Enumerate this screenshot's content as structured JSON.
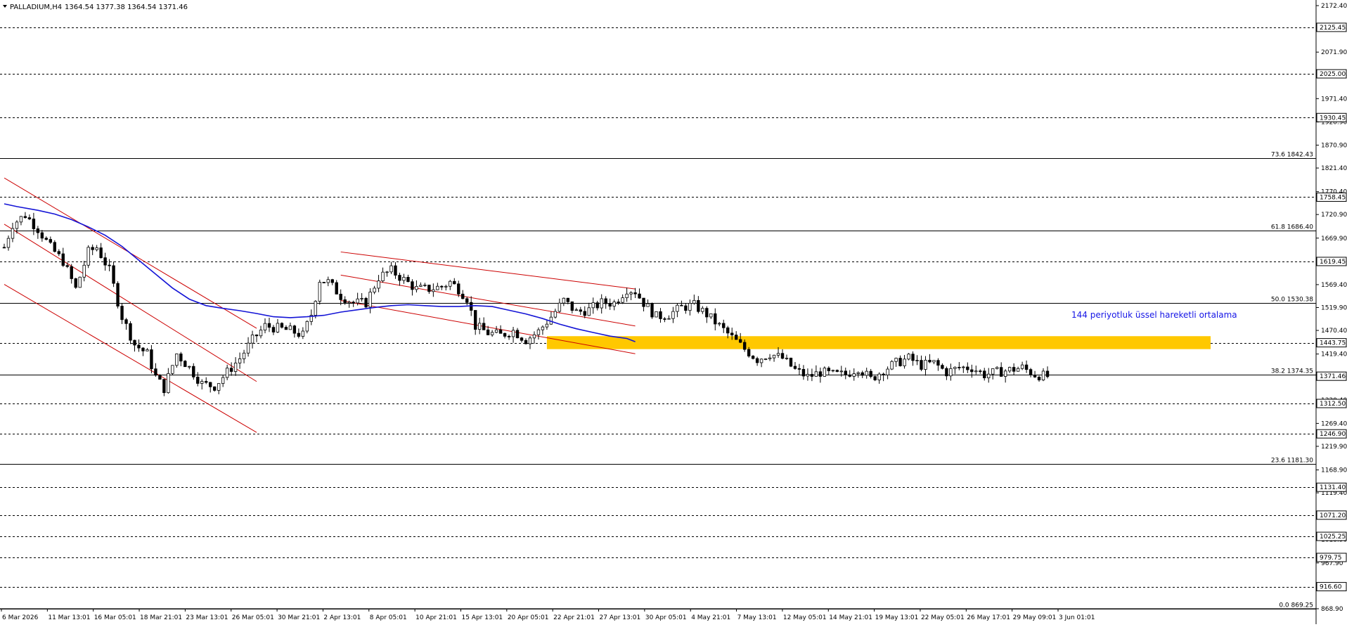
{
  "header": {
    "title": "PALLADIUM,H4",
    "ohlc": "1364.54 1377.38 1364.54 1371.46"
  },
  "annotation": {
    "text": "144 periyotluk üssel hareketli ortalama",
    "color": "#1515e6"
  },
  "colors": {
    "candles": "#000000",
    "ema": "#1414d6",
    "channels": "#cc0000",
    "zone": "#ffc800",
    "levels": "#000000",
    "background": "#ffffff"
  },
  "chart_data": {
    "type": "candlestick",
    "symbol": "PALLADIUM",
    "timeframe": "H4",
    "ylim": [
      868.9,
      2172.4
    ],
    "y_ticks": [
      "2172.40",
      "2121.40",
      "2071.90",
      "2021.40",
      "1971.40",
      "1920.90",
      "1870.90",
      "1821.40",
      "1770.40",
      "1720.90",
      "1669.90",
      "1619.40",
      "1569.40",
      "1519.90",
      "1470.40",
      "1419.40",
      "1369.90",
      "1320.40",
      "1269.40",
      "1219.90",
      "1168.90",
      "1119.40",
      "1068.40",
      "1018.90",
      "967.90",
      "916.90",
      "868.90"
    ],
    "x_labels": [
      "6 Mar 2026",
      "11 Mar 13:01",
      "16 Mar 05:01",
      "18 Mar 21:01",
      "23 Mar 13:01",
      "26 Mar 05:01",
      "30 Mar 21:01",
      "2 Apr 13:01",
      "8 Apr 05:01",
      "10 Apr 21:01",
      "15 Apr 13:01",
      "20 Apr 05:01",
      "22 Apr 21:01",
      "27 Apr 13:01",
      "30 Apr 05:01",
      "4 May 21:01",
      "7 May 13:01",
      "12 May 05:01",
      "14 May 21:01",
      "19 May 13:01",
      "22 May 05:01",
      "26 May 17:01",
      "29 May 09:01",
      "3 Jun 01:01"
    ],
    "horizontal_levels": [
      {
        "price": 2125.45,
        "label": "2125.45",
        "style": "dashed"
      },
      {
        "price": 2025.0,
        "label": "2025.00",
        "style": "dashed"
      },
      {
        "price": 1930.45,
        "label": "1930.45",
        "style": "dashed"
      },
      {
        "price": 1758.45,
        "label": "1758.45",
        "style": "dashed"
      },
      {
        "price": 1619.45,
        "label": "1619.45",
        "style": "dashed"
      },
      {
        "price": 1443.75,
        "label": "1443.75",
        "style": "dashed"
      },
      {
        "price": 1312.5,
        "label": "1312.50",
        "style": "dashed"
      },
      {
        "price": 1246.9,
        "label": "1246.90",
        "style": "dashed"
      },
      {
        "price": 1131.4,
        "label": "1131.40",
        "style": "dashed"
      },
      {
        "price": 1071.2,
        "label": "1071.20",
        "style": "dashed"
      },
      {
        "price": 1025.25,
        "label": "1025.25",
        "style": "dashed"
      },
      {
        "price": 979.75,
        "label": "979.75",
        "style": "dashed"
      },
      {
        "price": 916.6,
        "label": "916.60",
        "style": "dashed"
      }
    ],
    "current_price": {
      "price": 1371.46,
      "label": "1371.46"
    },
    "fibonacci": [
      {
        "level": "73.6",
        "price": 1842.43,
        "label": "73.6 1842.43"
      },
      {
        "level": "61.8",
        "price": 1686.4,
        "label": "61.8 1686.40"
      },
      {
        "level": "50.0",
        "price": 1530.38,
        "label": "50.0 1530.38"
      },
      {
        "level": "38.2",
        "price": 1374.35,
        "label": "38.2 1374.35"
      },
      {
        "level": "23.6",
        "price": 1181.3,
        "label": "23.6 1181.30"
      },
      {
        "level": "0.0",
        "price": 869.25,
        "label": "0.0 869.25"
      }
    ],
    "zone": {
      "price_from": 1430,
      "price_to": 1458
    },
    "ema_144": [
      [
        0,
        1744
      ],
      [
        3,
        1738
      ],
      [
        8,
        1730
      ],
      [
        12,
        1722
      ],
      [
        16,
        1710
      ],
      [
        20,
        1694
      ],
      [
        24,
        1676
      ],
      [
        28,
        1652
      ],
      [
        32,
        1622
      ],
      [
        36,
        1592
      ],
      [
        40,
        1562
      ],
      [
        44,
        1538
      ],
      [
        48,
        1524
      ],
      [
        52,
        1518
      ],
      [
        56,
        1513
      ],
      [
        60,
        1507
      ],
      [
        64,
        1500
      ],
      [
        68,
        1498
      ],
      [
        72,
        1500
      ],
      [
        76,
        1503
      ],
      [
        80,
        1510
      ],
      [
        84,
        1515
      ],
      [
        88,
        1520
      ],
      [
        92,
        1524
      ],
      [
        96,
        1526
      ],
      [
        100,
        1524
      ],
      [
        104,
        1522
      ],
      [
        108,
        1522
      ],
      [
        112,
        1524
      ],
      [
        116,
        1522
      ],
      [
        120,
        1514
      ],
      [
        124,
        1506
      ],
      [
        128,
        1496
      ],
      [
        132,
        1484
      ],
      [
        136,
        1474
      ],
      [
        140,
        1466
      ],
      [
        144,
        1458
      ],
      [
        148,
        1453
      ],
      [
        150,
        1446
      ]
    ],
    "candle_path": [
      [
        0,
        1650
      ],
      [
        2,
        1700
      ],
      [
        5,
        1720
      ],
      [
        8,
        1690
      ],
      [
        11,
        1650
      ],
      [
        14,
        1620
      ],
      [
        17,
        1560
      ],
      [
        20,
        1640
      ],
      [
        22,
        1650
      ],
      [
        25,
        1600
      ],
      [
        28,
        1500
      ],
      [
        31,
        1440
      ],
      [
        34,
        1420
      ],
      [
        36,
        1370
      ],
      [
        38,
        1345
      ],
      [
        41,
        1420
      ],
      [
        44,
        1390
      ],
      [
        47,
        1355
      ],
      [
        50,
        1350
      ],
      [
        53,
        1380
      ],
      [
        56,
        1410
      ],
      [
        59,
        1450
      ],
      [
        62,
        1480
      ],
      [
        65,
        1475
      ],
      [
        68,
        1470
      ],
      [
        71,
        1460
      ],
      [
        73,
        1505
      ],
      [
        75,
        1580
      ],
      [
        77,
        1575
      ],
      [
        80,
        1545
      ],
      [
        83,
        1530
      ],
      [
        86,
        1530
      ],
      [
        89,
        1585
      ],
      [
        92,
        1600
      ],
      [
        95,
        1580
      ],
      [
        98,
        1560
      ],
      [
        101,
        1560
      ],
      [
        104,
        1565
      ],
      [
        106,
        1575
      ],
      [
        108,
        1560
      ],
      [
        110,
        1540
      ],
      [
        112,
        1480
      ],
      [
        115,
        1465
      ],
      [
        118,
        1460
      ],
      [
        121,
        1470
      ],
      [
        124,
        1450
      ],
      [
        127,
        1468
      ],
      [
        130,
        1500
      ],
      [
        133,
        1535
      ],
      [
        136,
        1510
      ],
      [
        139,
        1515
      ],
      [
        142,
        1530
      ],
      [
        145,
        1530
      ],
      [
        148,
        1560
      ],
      [
        150,
        1555
      ],
      [
        152,
        1530
      ],
      [
        155,
        1500
      ],
      [
        158,
        1505
      ],
      [
        161,
        1520
      ],
      [
        164,
        1525
      ],
      [
        167,
        1505
      ],
      [
        170,
        1480
      ],
      [
        173,
        1455
      ],
      [
        176,
        1430
      ],
      [
        179,
        1408
      ],
      [
        182,
        1420
      ],
      [
        185,
        1410
      ],
      [
        188,
        1385
      ],
      [
        191,
        1370
      ],
      [
        194,
        1380
      ],
      [
        197,
        1375
      ],
      [
        200,
        1375
      ],
      [
        203,
        1390
      ],
      [
        206,
        1365
      ],
      [
        209,
        1385
      ],
      [
        212,
        1400
      ],
      [
        215,
        1410
      ],
      [
        218,
        1395
      ],
      [
        221,
        1400
      ],
      [
        224,
        1380
      ],
      [
        227,
        1390
      ],
      [
        230,
        1390
      ],
      [
        233,
        1375
      ],
      [
        236,
        1380
      ],
      [
        239,
        1385
      ],
      [
        242,
        1390
      ],
      [
        245,
        1375
      ],
      [
        248,
        1371
      ]
    ],
    "channels": [
      {
        "name": "descending-channel-1-upper",
        "x1": 0,
        "y1": 1800,
        "x2": 60,
        "y2": 1475
      },
      {
        "name": "descending-channel-1-mid",
        "x1": 0,
        "y1": 1700,
        "x2": 60,
        "y2": 1360
      },
      {
        "name": "descending-channel-1-lower",
        "x1": 0,
        "y1": 1570,
        "x2": 60,
        "y2": 1250
      },
      {
        "name": "descending-channel-2-upper",
        "x1": 80,
        "y1": 1640,
        "x2": 150,
        "y2": 1560
      },
      {
        "name": "descending-channel-2-mid",
        "x1": 80,
        "y1": 1590,
        "x2": 150,
        "y2": 1480
      },
      {
        "name": "descending-channel-2-lower",
        "x1": 80,
        "y1": 1535,
        "x2": 150,
        "y2": 1420
      }
    ]
  }
}
